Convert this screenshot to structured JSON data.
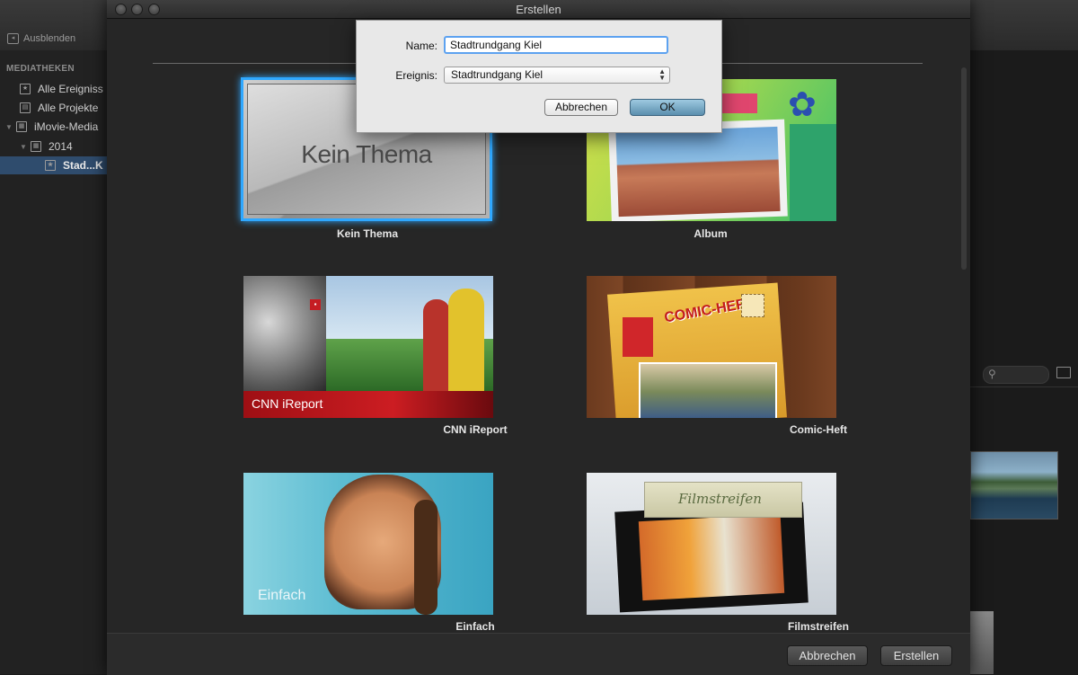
{
  "background_app": {
    "hide_button": "Ausblenden",
    "sidebar": {
      "header": "MEDIATHEKEN",
      "items": [
        {
          "label": "Alle Ereigniss",
          "icon": "star-icon"
        },
        {
          "label": "Alle Projekte",
          "icon": "clapper-icon"
        },
        {
          "label": "iMovie-Media",
          "icon": "grid-icon"
        },
        {
          "label": "2014",
          "icon": "calendar-icon"
        },
        {
          "label": "Stad...K",
          "icon": "star-icon"
        }
      ]
    }
  },
  "window": {
    "title": "Erstellen"
  },
  "themes": [
    {
      "name": "Kein Thema",
      "caption": "Kein Thema",
      "selected": true
    },
    {
      "name": "Album",
      "caption": "Album"
    },
    {
      "name": "CNN iReport",
      "caption": "CNN iReport"
    },
    {
      "name": "Comic-Heft",
      "caption": "COMIC-HEFT"
    },
    {
      "name": "Einfach",
      "caption": "Einfach"
    },
    {
      "name": "Filmstreifen",
      "caption": "Filmstreifen"
    }
  ],
  "bottom_bar": {
    "cancel_label": "Abbrechen",
    "create_label": "Erstellen"
  },
  "dialog": {
    "name_label": "Name:",
    "name_value": "Stadtrundgang Kiel",
    "event_label": "Ereignis:",
    "event_value": "Stadtrundgang Kiel",
    "cancel_label": "Abbrechen",
    "ok_label": "OK"
  },
  "colors": {
    "selection_accent": "#2fa8ff",
    "sidebar_selection": "#2f4c6d",
    "cnn_red": "#cc1d22"
  }
}
